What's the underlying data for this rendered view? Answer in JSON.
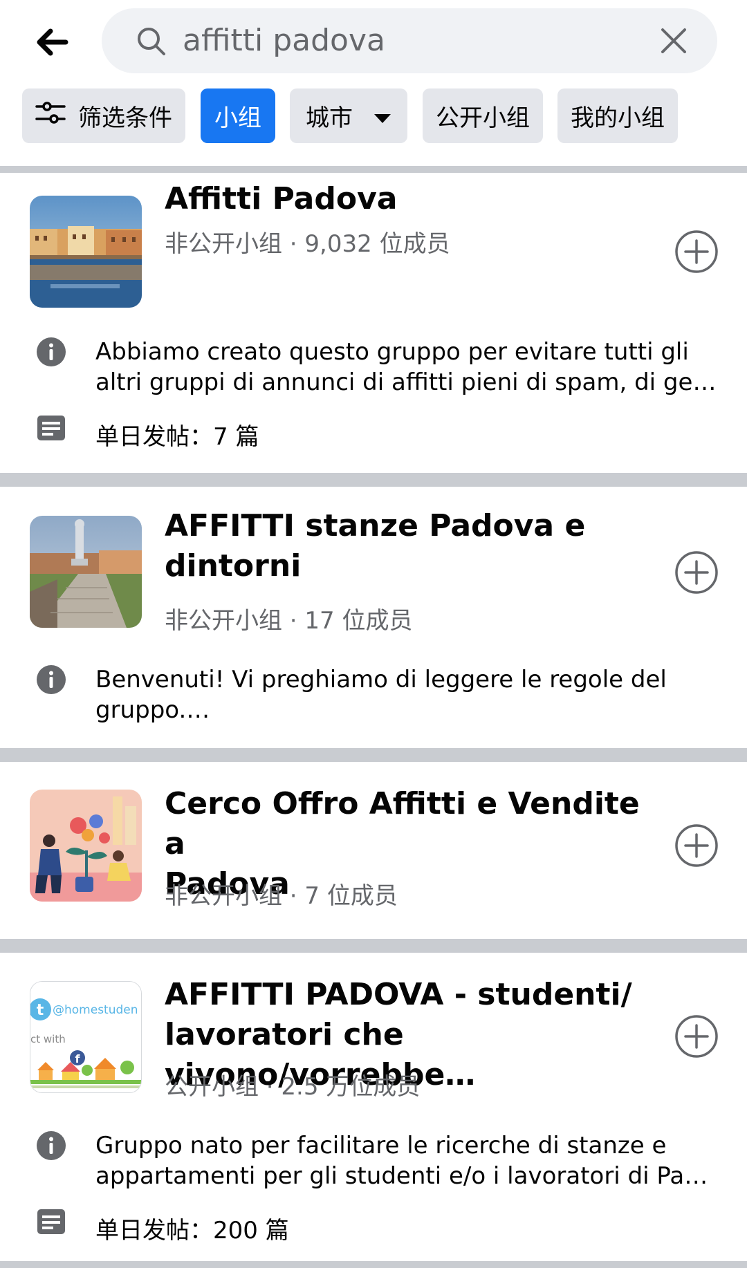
{
  "search": {
    "query": "affitti padova"
  },
  "filters": {
    "filter_label": "筛选条件",
    "groups_label": "小组",
    "city_label": "城市",
    "public_label": "公开小组",
    "mine_label": "我的小组"
  },
  "results": [
    {
      "title": "Affitti Padova",
      "meta": "非公开小组 · 9,032 位成员",
      "desc_line1": "Abbiamo creato questo gruppo per evitare tutti gli",
      "desc_line2": "altri gruppi di annunci di affitti pieni di spam, di gente…",
      "posts": "单日发帖：7 篇"
    },
    {
      "title_line1": "AFFITTI stanze Padova e",
      "title_line2": "dintorni",
      "meta": "非公开小组 · 17 位成员",
      "desc_line1": "Benvenuti! Vi preghiamo di leggere le regole del",
      "desc_line2": "gruppo.…"
    },
    {
      "title_line1": "Cerco Offro Affitti e Vendite a",
      "title_line2": "Padova",
      "meta": "非公开小组 · 7 位成员"
    },
    {
      "title_line1": "AFFITTI PADOVA - studenti/",
      "title_line2": "lavoratori che vivono/vorrebbe…",
      "meta": "公开小组 · 2.5 万位成员",
      "desc_line1": "Gruppo nato per facilitare le ricerche di stanze e",
      "desc_line2": "appartamenti per gli studenti e/o i lavoratori di Pado…",
      "posts": "单日发帖：200 篇",
      "thumb_text": "@homestuden",
      "thumb_text2": "ct with"
    }
  ],
  "colors": {
    "accent": "#1877f2",
    "chip_bg": "#e4e6eb",
    "divider": "#c9ccd1",
    "secondary_text": "#65676b"
  },
  "icons": [
    "back-arrow-icon",
    "search-icon",
    "close-icon",
    "filter-sliders-icon",
    "caret-down-icon",
    "info-icon",
    "post-icon",
    "plus-circle-icon"
  ]
}
